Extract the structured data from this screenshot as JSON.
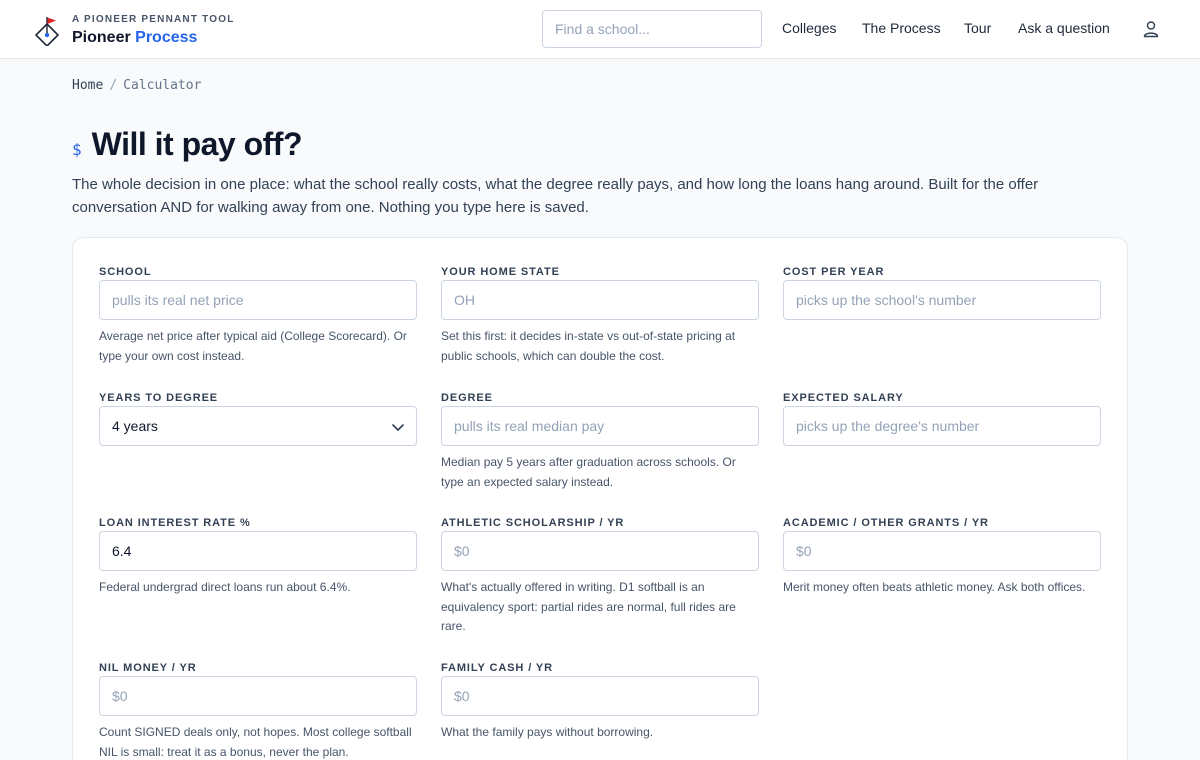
{
  "header": {
    "brand_kicker": "A PIONEER PENNANT TOOL",
    "brand_name_primary": "Pioneer",
    "brand_name_accent": "Process",
    "search_placeholder": "Find a school...",
    "nav": [
      "Colleges",
      "The Process",
      "Tour",
      "Ask a question"
    ],
    "logo_icon": "pennant-compass-icon",
    "user_icon": "user-icon"
  },
  "breadcrumb": {
    "home": "Home",
    "separator": "/",
    "current": "Calculator"
  },
  "page": {
    "icon_glyph": "$",
    "title": "Will it pay off?",
    "intro": "The whole decision in one place: what the school really costs, what the degree really pays, and how long the loans hang around. Built for the offer conversation AND for walking away from one. Nothing you type here is saved."
  },
  "form": {
    "school": {
      "label": "SCHOOL",
      "placeholder": "pulls its real net price",
      "help": "Average net price after typical aid (College Scorecard). Or type your own cost instead."
    },
    "home_state": {
      "label": "YOUR HOME STATE",
      "placeholder": "OH",
      "help": "Set this first: it decides in-state vs out-of-state pricing at public schools, which can double the cost."
    },
    "cost_per_year": {
      "label": "COST PER YEAR",
      "placeholder": "picks up the school's number"
    },
    "years_to_degree": {
      "label": "YEARS TO DEGREE",
      "value": "4 years"
    },
    "degree": {
      "label": "DEGREE",
      "placeholder": "pulls its real median pay",
      "help": "Median pay 5 years after graduation across schools. Or type an expected salary instead."
    },
    "expected_salary": {
      "label": "EXPECTED SALARY",
      "placeholder": "picks up the degree's number"
    },
    "loan_rate": {
      "label": "LOAN INTEREST RATE %",
      "value": "6.4",
      "help": "Federal undergrad direct loans run about 6.4%."
    },
    "athletic": {
      "label": "ATHLETIC SCHOLARSHIP / YR",
      "placeholder": "$0",
      "help": "What's actually offered in writing. D1 softball is an equivalency sport: partial rides are normal, full rides are rare."
    },
    "grants": {
      "label": "ACADEMIC / OTHER GRANTS / YR",
      "placeholder": "$0",
      "help": "Merit money often beats athletic money. Ask both offices."
    },
    "nil": {
      "label": "NIL MONEY / YR",
      "placeholder": "$0",
      "help": "Count SIGNED deals only, not hopes. Most college softball NIL is small: treat it as a bonus, never the plan."
    },
    "family_cash": {
      "label": "FAMILY CASH / YR",
      "placeholder": "$0",
      "help": "What the family pays without borrowing."
    }
  },
  "colors": {
    "accent": "#2563eb",
    "text": "#0f172a",
    "muted": "#475569",
    "border": "#cbd5e1",
    "background": "#f8fafc",
    "pennant": "#dc2626"
  }
}
